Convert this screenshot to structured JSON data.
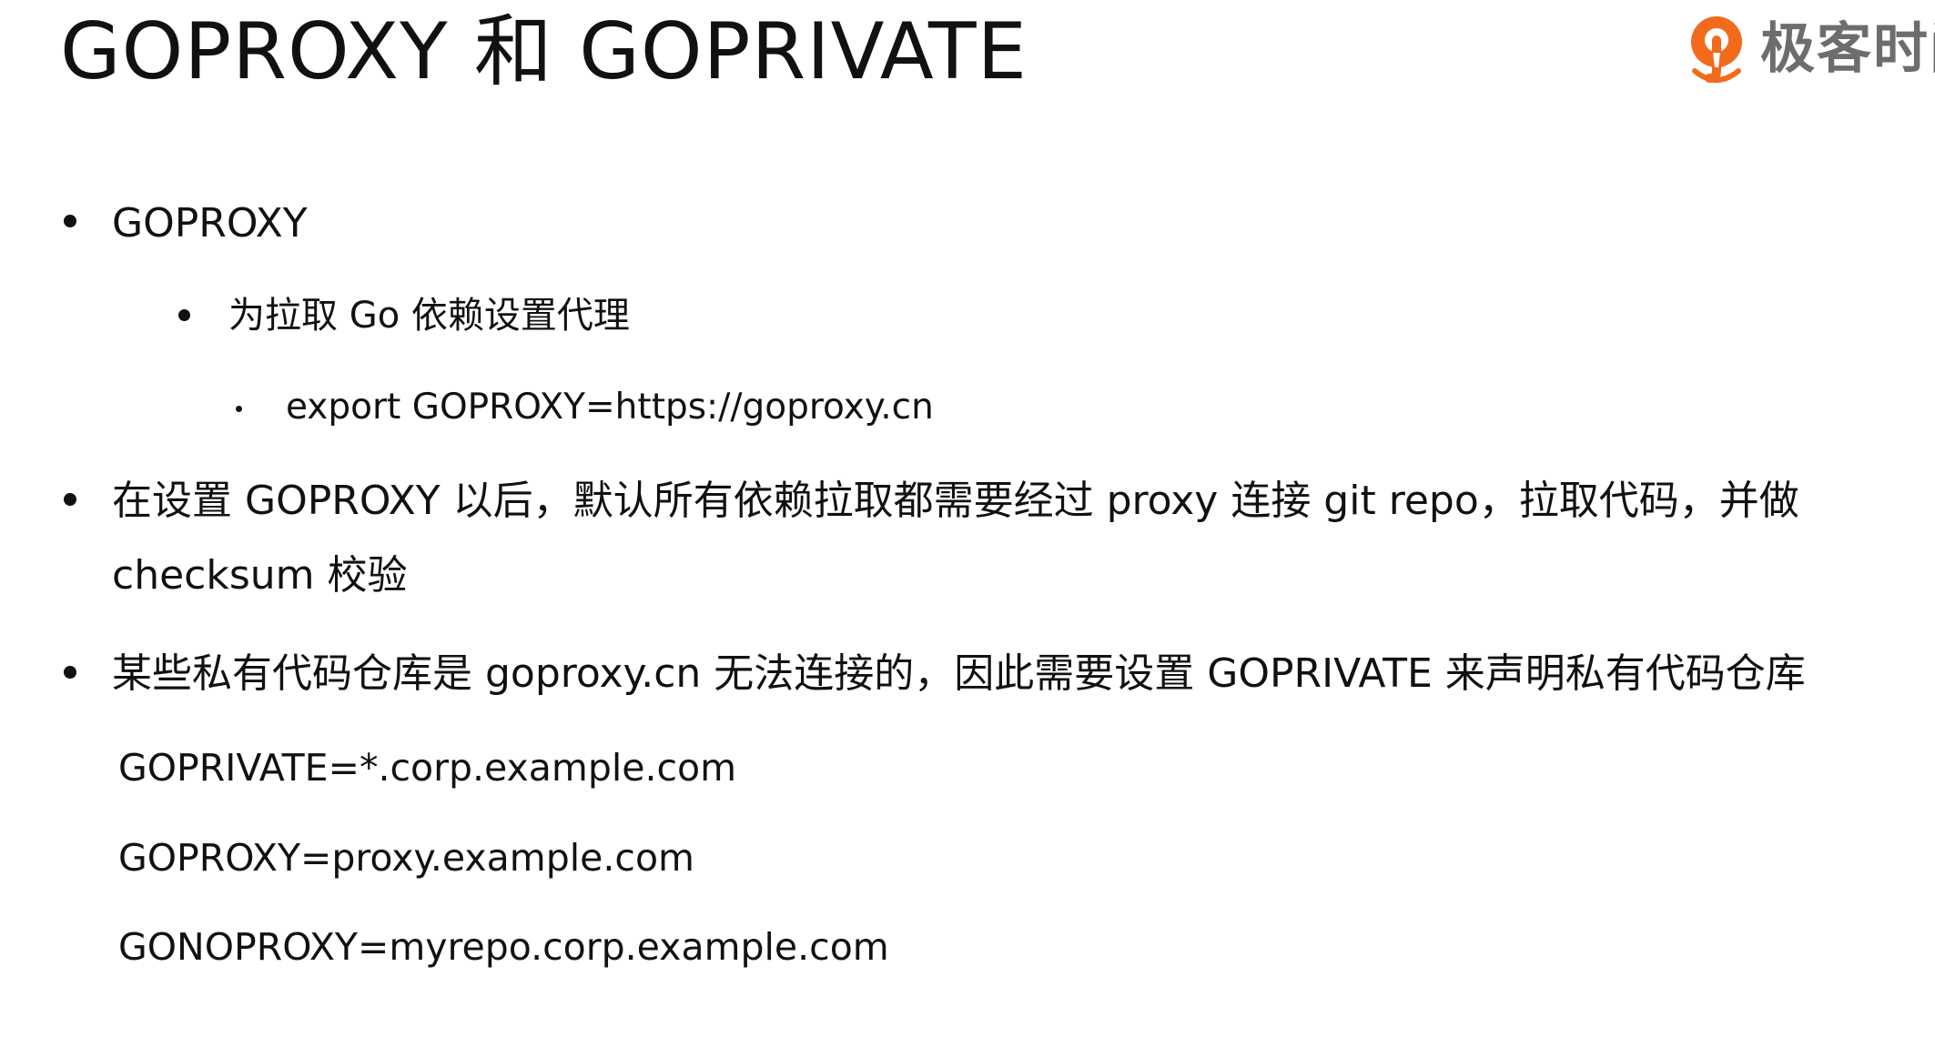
{
  "title": "GOPROXY 和 GOPRIVATE",
  "logo": {
    "text": "极客时间",
    "brand_color": "#f26b1d"
  },
  "bullets": [
    {
      "text": "GOPROXY"
    },
    {
      "text": "为拉取 Go 依赖设置代理"
    },
    {
      "text": "export GOPROXY=https://goproxy.cn"
    },
    {
      "line1": "在设置 GOPROXY 以后，默认所有依赖拉取都需要经过 proxy 连接 git repo，拉取代码，并做",
      "line2": "checksum 校验"
    },
    {
      "text": "某些私有代码仓库是 goproxy.cn 无法连接的，因此需要设置 GOPRIVATE 来声明私有代码仓库"
    }
  ],
  "examples": [
    "GOPRIVATE=*.corp.example.com",
    "GOPROXY=proxy.example.com",
    "GONOPROXY=myrepo.corp.example.com"
  ]
}
